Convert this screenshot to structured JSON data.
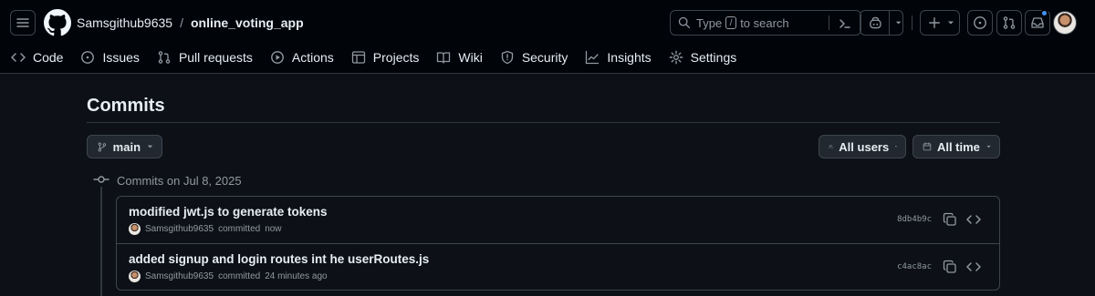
{
  "header": {
    "owner": "Samsgithub9635",
    "separator": "/",
    "repo": "online_voting_app",
    "search": {
      "prefix": "Type",
      "key": "/",
      "suffix": "to search"
    }
  },
  "tabs": [
    {
      "label": "Code",
      "icon": "code-icon"
    },
    {
      "label": "Issues",
      "icon": "issue-icon"
    },
    {
      "label": "Pull requests",
      "icon": "pull-request-icon"
    },
    {
      "label": "Actions",
      "icon": "play-icon"
    },
    {
      "label": "Projects",
      "icon": "table-icon"
    },
    {
      "label": "Wiki",
      "icon": "book-icon"
    },
    {
      "label": "Security",
      "icon": "shield-icon"
    },
    {
      "label": "Insights",
      "icon": "graph-icon"
    },
    {
      "label": "Settings",
      "icon": "gear-icon"
    }
  ],
  "page": {
    "title": "Commits",
    "branch": "main",
    "users_filter": "All users",
    "time_filter": "All time"
  },
  "commit_group": {
    "label": "Commits on Jul 8, 2025",
    "commits": [
      {
        "message": "modified jwt.js to generate tokens",
        "author": "Samsgithub9635",
        "action": "committed",
        "time": "now",
        "sha": "8db4b9c"
      },
      {
        "message": "added signup and login routes int he userRoutes.js",
        "author": "Samsgithub9635",
        "action": "committed",
        "time": "24 minutes ago",
        "sha": "c4ac8ac"
      }
    ]
  },
  "colors": {
    "background": "#0d1117",
    "header": "#010409",
    "border": "#3d444d",
    "muted": "#9198a1",
    "text": "#e6edf3",
    "notification": "#4493f8"
  }
}
